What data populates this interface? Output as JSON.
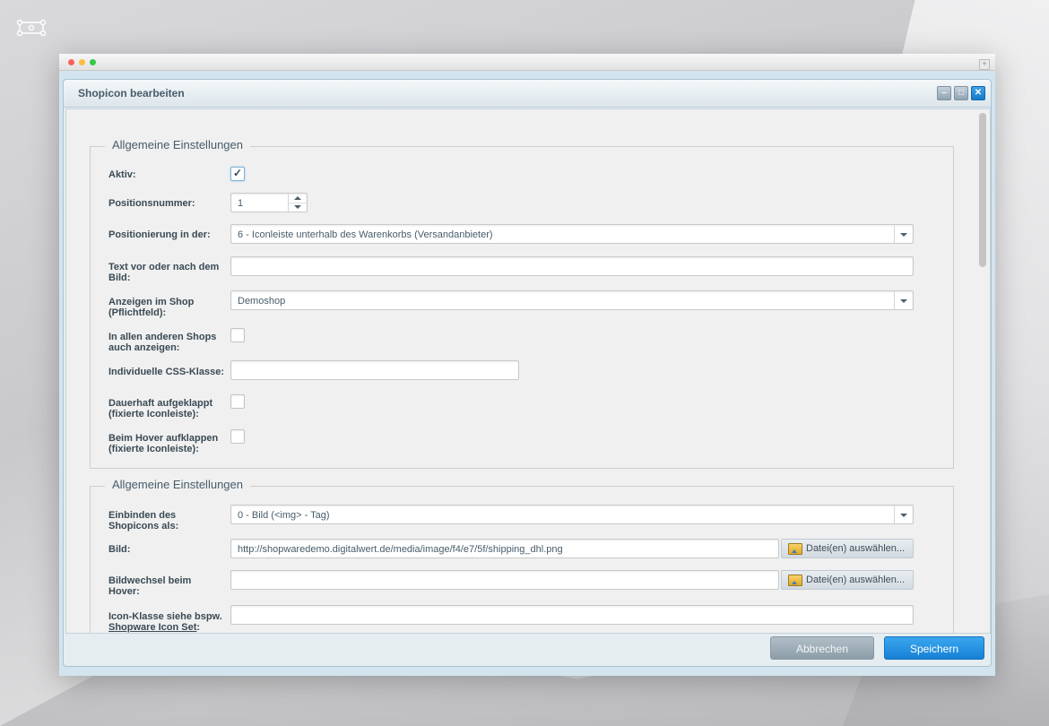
{
  "dialog": {
    "title": "Shopicon bearbeiten"
  },
  "section1": {
    "legend": "Allgemeine Einstellungen",
    "aktiv_label": "Aktiv:",
    "aktiv_checked": true,
    "position_label": "Positionsnummer:",
    "position_value": "1",
    "positionierung_label": "Positionierung in der:",
    "positionierung_value": "6 - Iconleiste unterhalb des Warenkorbs (Versandanbieter)",
    "text_label_1": "Text vor oder nach dem",
    "text_label_2": "Bild:",
    "text_value": "",
    "shop_label_1": "Anzeigen im Shop",
    "shop_label_2": "(Pflichtfeld):",
    "shop_value": "Demoshop",
    "alle_shops_label_1": "In allen anderen Shops",
    "alle_shops_label_2": "auch anzeigen:",
    "css_label": "Individuelle CSS-Klasse:",
    "css_value": "",
    "dauerhaft_label_1": "Dauerhaft aufgeklappt",
    "dauerhaft_label_2": "(fixierte Iconleiste):",
    "hover_label_1": "Beim Hover aufklappen",
    "hover_label_2": "(fixierte Iconleiste):"
  },
  "section2": {
    "legend": "Allgemeine Einstellungen",
    "einbinden_label_1": "Einbinden des",
    "einbinden_label_2": "Shopicons als:",
    "einbinden_value": "0 - Bild (<img> - Tag)",
    "bild_label": "Bild:",
    "bild_value": "http://shopwaredemo.digitalwert.de/media/image/f4/e7/5f/shipping_dhl.png",
    "file_button_label": "Datei(en) auswählen...",
    "bildwechsel_label_1": "Bildwechsel beim",
    "bildwechsel_label_2": "Hover:",
    "bildwechsel_value": "",
    "iconklasse_label_1": "Icon-Klasse siehe bspw.",
    "iconklasse_label_2": "Shopware Icon Set",
    "iconklasse_label_3": ":",
    "iconklasse_value": ""
  },
  "footer": {
    "cancel_label": "Abbrechen",
    "save_label": "Speichern"
  },
  "colors": {
    "accent": "#1780d6",
    "label": "#3a4a55",
    "legend": "#475c6b"
  }
}
